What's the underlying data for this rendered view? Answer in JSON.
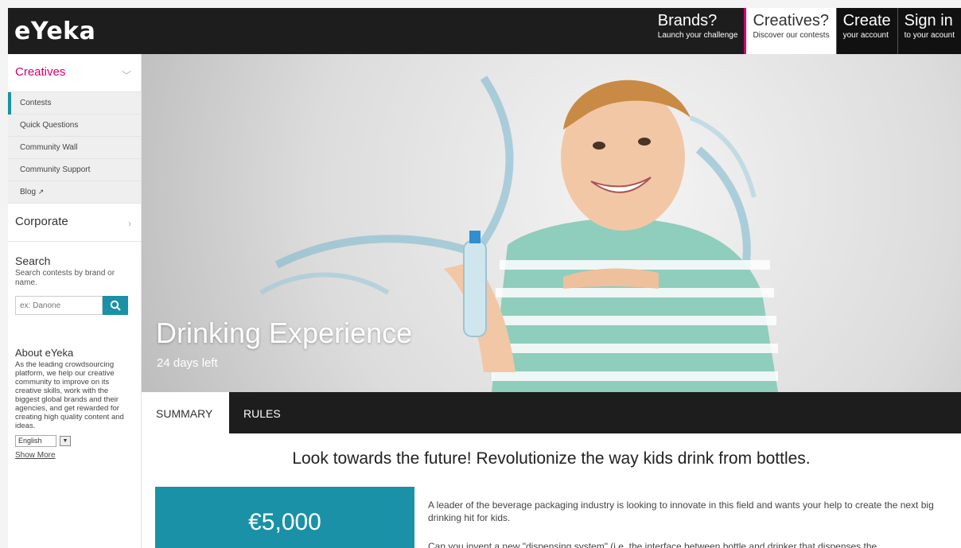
{
  "header": {
    "logo": "eYeka",
    "nav": [
      {
        "title": "Brands?",
        "sub": "Launch your challenge"
      },
      {
        "title": "Creatives?",
        "sub": "Discover our contests"
      },
      {
        "title": "Create",
        "sub": "your account"
      },
      {
        "title": "Sign in",
        "sub": "to your acount"
      }
    ]
  },
  "sidebar": {
    "creatives_label": "Creatives",
    "items": [
      "Contests",
      "Quick Questions",
      "Community Wall",
      "Community Support",
      "Blog"
    ],
    "corporate_label": "Corporate",
    "search": {
      "heading": "Search",
      "description": "Search contests by brand or name.",
      "placeholder": "ex: Danone"
    },
    "about": {
      "heading": "About eYeka",
      "text": "As the leading crowdsourcing platform, we help our creative community to improve on its creative skills, work with the biggest global brands and their agencies, and get rewarded for creating high quality content and ideas.",
      "language": "English",
      "show_more": "Show More"
    }
  },
  "hero": {
    "title": "Drinking Experience",
    "days_left": "24 days left"
  },
  "tabs": [
    "SUMMARY",
    "RULES"
  ],
  "content": {
    "headline": "Look towards the future! Revolutionize the way kids drink from bottles.",
    "prize": "€5,000",
    "paragraph1": "A leader of the beverage packaging industry is looking to innovate in this field and wants your help to create the next big drinking hit for kids.",
    "paragraph2": "Can you invent a new \"dispensing system\" (i.e. the interface between bottle and drinker that dispenses the"
  },
  "colors": {
    "accent_teal": "#1a91a6",
    "accent_pink": "#d6006f",
    "dark_bar": "#1d1d1d"
  }
}
